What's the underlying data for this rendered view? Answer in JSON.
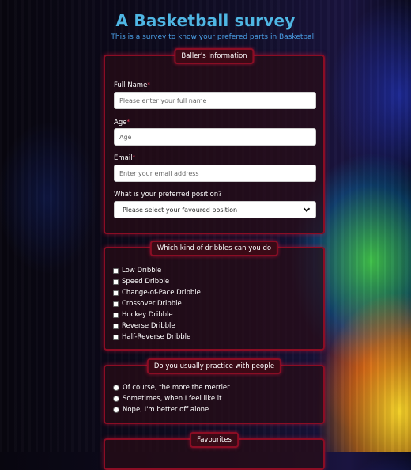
{
  "header": {
    "title": "A Basketball survey",
    "subtitle": "This is a survey to know your prefered parts in Basketball"
  },
  "info": {
    "legend": "Baller's Information",
    "fullname_label": "Full Name",
    "fullname_placeholder": "Please enter your full name",
    "age_label": "Age",
    "age_placeholder": "Age",
    "email_label": "Email",
    "email_placeholder": "Enter your email address",
    "position_label": "What is your preferred position?",
    "position_selected": "Please select your favoured position",
    "required_marker": "*"
  },
  "dribbles": {
    "legend": "Which kind of dribbles can you do",
    "options": [
      "Low Dribble",
      "Speed Dribble",
      "Change-of-Pace Dribble",
      "Crossover Dribble",
      "Hockey Dribble",
      "Reverse Dribble",
      "Half-Reverse Dribble"
    ]
  },
  "practice": {
    "legend": "Do you usually practice with people",
    "options": [
      "Of course, the more the merrier",
      "Sometimes, when I feel like it",
      "Nope, I'm better off alone"
    ]
  },
  "favourites": {
    "legend": "Favourites"
  },
  "colors": {
    "title": "#4fb6e3",
    "accent_border": "#8b0d24",
    "required": "#ff4060"
  }
}
